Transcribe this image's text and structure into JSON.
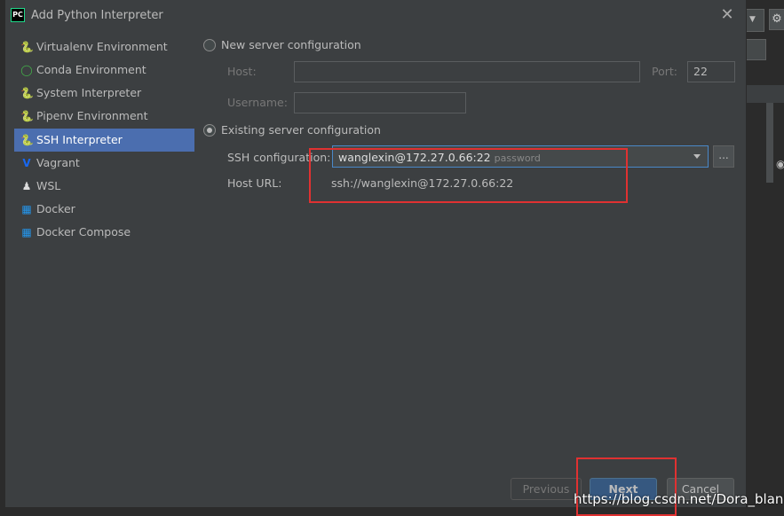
{
  "dialog": {
    "title": "Add Python Interpreter",
    "app_icon_text": "PC"
  },
  "sidebar": {
    "items": [
      {
        "label": "Virtualenv Environment",
        "icon": "virtualenv-icon"
      },
      {
        "label": "Conda Environment",
        "icon": "conda-icon"
      },
      {
        "label": "System Interpreter",
        "icon": "python-icon"
      },
      {
        "label": "Pipenv Environment",
        "icon": "pipenv-icon"
      },
      {
        "label": "SSH Interpreter",
        "icon": "ssh-icon",
        "selected": true
      },
      {
        "label": "Vagrant",
        "icon": "vagrant-icon"
      },
      {
        "label": "WSL",
        "icon": "linux-icon"
      },
      {
        "label": "Docker",
        "icon": "docker-icon"
      },
      {
        "label": "Docker Compose",
        "icon": "docker-compose-icon"
      }
    ]
  },
  "form": {
    "new_server": {
      "label": "New server configuration",
      "selected": false,
      "host_label": "Host:",
      "host_value": "",
      "port_label": "Port:",
      "port_value": "22",
      "username_label": "Username:",
      "username_value": ""
    },
    "existing_server": {
      "label": "Existing server configuration",
      "selected": true,
      "ssh_config_label": "SSH configuration:",
      "ssh_config_value": "wanglexin@172.27.0.66:22",
      "ssh_config_auth": "password",
      "browse_label": "...",
      "host_url_label": "Host URL:",
      "host_url_value": "ssh://wanglexin@172.27.0.66:22"
    }
  },
  "buttons": {
    "previous": "Previous",
    "next": "Next",
    "cancel": "Cancel"
  },
  "watermark": "https://blog.csdn.net/Dora_blank",
  "colors": {
    "background": "#3c3f41",
    "selection": "#4b6eaf",
    "primary_button": "#365880",
    "annotation": "#e03131"
  }
}
